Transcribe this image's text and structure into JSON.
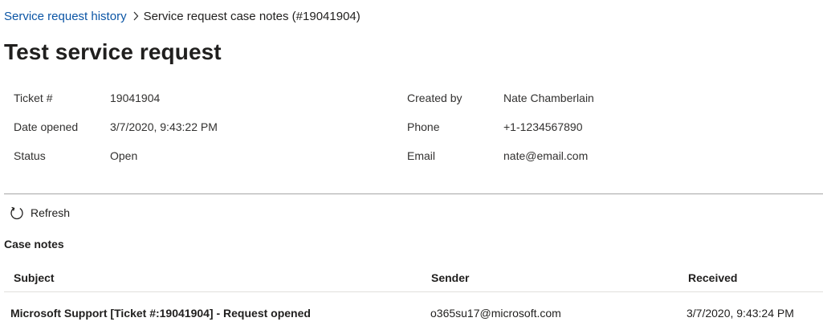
{
  "breadcrumb": {
    "parent": "Service request history",
    "current": "Service request case notes (#19041904)"
  },
  "title": "Test service request",
  "details": {
    "ticket": {
      "label": "Ticket #",
      "value": "19041904"
    },
    "date_opened": {
      "label": "Date opened",
      "value": "3/7/2020, 9:43:22 PM"
    },
    "status": {
      "label": "Status",
      "value": "Open"
    },
    "created_by": {
      "label": "Created by",
      "value": "Nate Chamberlain"
    },
    "phone": {
      "label": "Phone",
      "value": "+1-1234567890"
    },
    "email": {
      "label": "Email",
      "value": "nate@email.com"
    }
  },
  "toolbar": {
    "refresh_label": "Refresh"
  },
  "case_notes": {
    "heading": "Case notes",
    "columns": [
      "Subject",
      "Sender",
      "Received"
    ],
    "rows": [
      {
        "subject": "Microsoft Support [Ticket #:19041904] - Request opened",
        "sender": "o365su17@microsoft.com",
        "received": "3/7/2020, 9:43:24 PM"
      }
    ]
  },
  "colors": {
    "link": "#0b55a5",
    "text": "#201f1e",
    "divider": "#a6a6a6"
  },
  "icons": {
    "breadcrumb_separator": "chevron-right-icon",
    "refresh": "refresh-icon"
  }
}
